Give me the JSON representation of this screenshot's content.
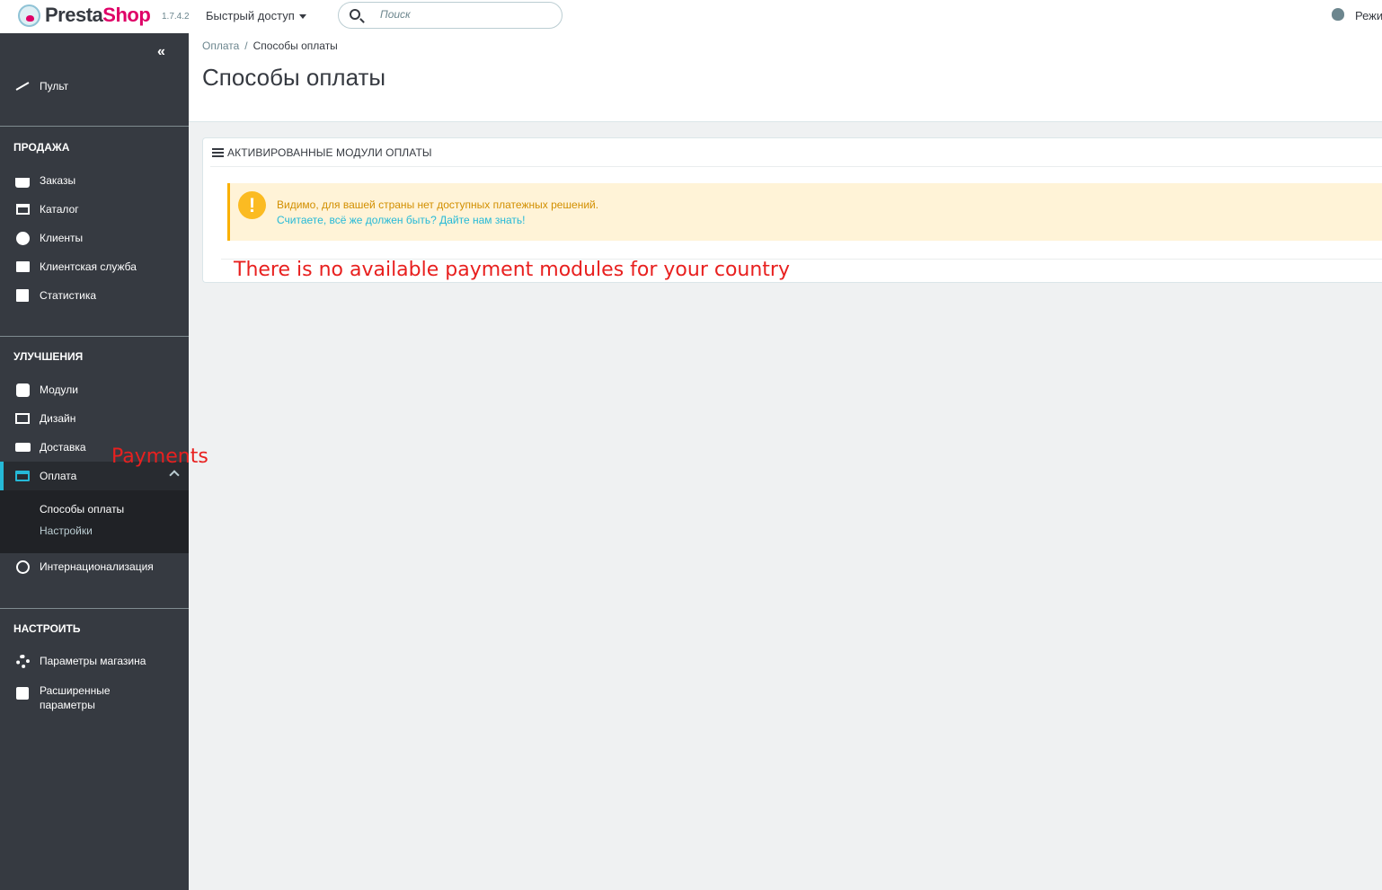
{
  "header": {
    "logo_presta": "Presta",
    "logo_shop": "Shop",
    "version": "1.7.4.2",
    "quick_access": "Быстрый доступ",
    "search_placeholder": "Поиск",
    "debug_label": "Режим"
  },
  "sidebar": {
    "dashboard": "Пульт",
    "sections": {
      "sell": "ПРОДАЖА",
      "improve": "УЛУЧШЕНИЯ",
      "configure": "НАСТРОИТЬ"
    },
    "sell_items": [
      "Заказы",
      "Каталог",
      "Клиенты",
      "Клиентская служба",
      "Статистика"
    ],
    "improve_items": [
      "Модули",
      "Дизайн",
      "Доставка",
      "Оплата"
    ],
    "payment_sub": [
      "Способы оплаты",
      "Настройки"
    ],
    "international": "Интернационализация",
    "configure_items": [
      "Параметры магазина",
      "Расширенные параметры"
    ],
    "active_color": "#25b9d7"
  },
  "main": {
    "breadcrumb": {
      "parent": "Оплата",
      "current": "Способы оплаты"
    },
    "title": "Способы оплаты",
    "panel": {
      "title": "АКТИВИРОВАННЫЕ МОДУЛИ ОПЛАТЫ",
      "alert_text": "Видимо, для вашей страны нет доступных платежных решений.",
      "alert_link": "Считаете, всё же должен быть? Дайте нам знать!"
    }
  },
  "annotations": {
    "main": "There is no available payment modules for your country",
    "sidebar": "Payments"
  }
}
